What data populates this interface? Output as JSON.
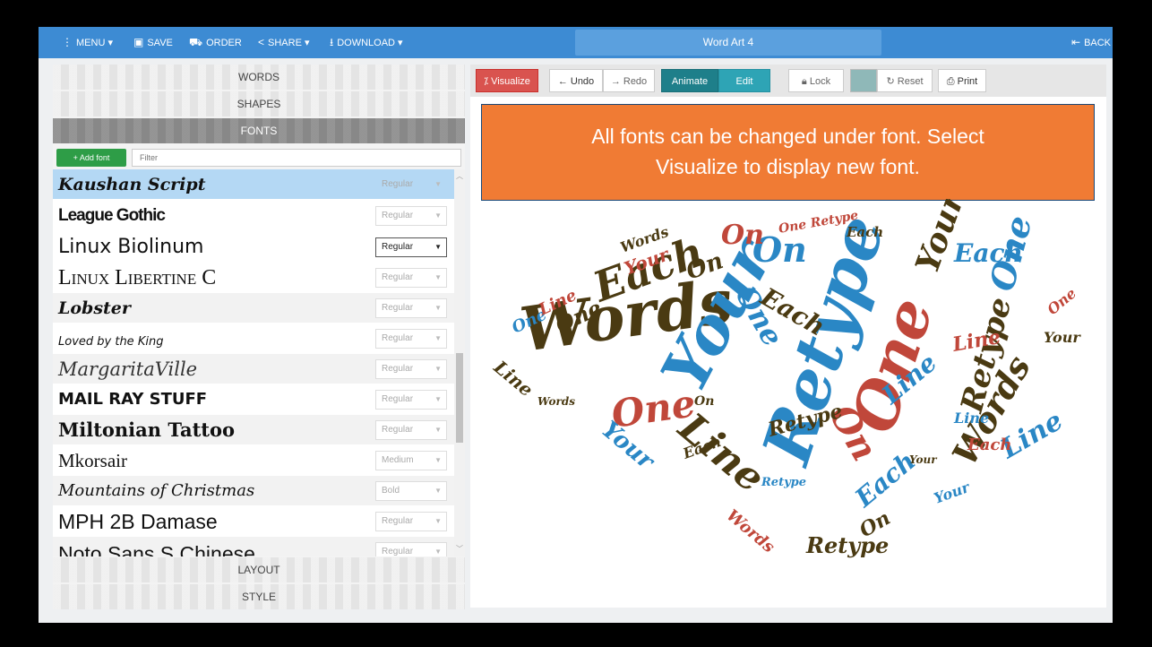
{
  "nav": {
    "menu": "MENU",
    "save": "SAVE",
    "order": "ORDER",
    "share": "SHARE",
    "download": "DOWNLOAD",
    "title": "Word Art 4",
    "back": "BACK"
  },
  "accordion": {
    "words": "WORDS",
    "shapes": "SHAPES",
    "fonts": "FONTS",
    "layout": "LAYOUT",
    "style": "STYLE"
  },
  "fonts_panel": {
    "add_font": "+ Add font",
    "filter_placeholder": "Filter",
    "items": [
      {
        "name": "Kaushan Script",
        "weight": "Regular"
      },
      {
        "name": "League Gothic",
        "weight": "Regular"
      },
      {
        "name": "Linux Biolinum",
        "weight": "Regular"
      },
      {
        "name": "Linux Libertine C",
        "weight": "Regular"
      },
      {
        "name": "Lobster",
        "weight": "Regular"
      },
      {
        "name": "Loved by the King",
        "weight": "Regular"
      },
      {
        "name": "MargaritaVille",
        "weight": "Regular"
      },
      {
        "name": "MAIL RAY STUFF",
        "weight": "Regular"
      },
      {
        "name": "Miltonian Tattoo",
        "weight": "Regular"
      },
      {
        "name": "Mkorsair",
        "weight": "Medium"
      },
      {
        "name": "Mountains of Christmas",
        "weight": "Bold"
      },
      {
        "name": "MPH 2B Damase",
        "weight": "Regular"
      },
      {
        "name": "Noto Sans S Chinese",
        "weight": "Regular"
      }
    ]
  },
  "toolbar": {
    "visualize": "Visualize",
    "undo": "Undo",
    "redo": "Redo",
    "animate": "Animate",
    "edit": "Edit",
    "lock": "Lock",
    "reset": "Reset",
    "print": "Print"
  },
  "banner": {
    "line1": "All fonts can be changed under font. Select",
    "line2": "Visualize to display new font."
  },
  "cloud_words": [
    "Words",
    "Your",
    "Retype",
    "One",
    "Line",
    "Each",
    "On"
  ],
  "colors": {
    "nav": "#3d8bd3",
    "visualize": "#d9534f",
    "animate": "#1e7f8a",
    "edit": "#2ea4b5",
    "banner": "#f07b34",
    "word_blue": "#2a87c5",
    "word_brown": "#4a3a12",
    "word_red": "#c0473a"
  }
}
